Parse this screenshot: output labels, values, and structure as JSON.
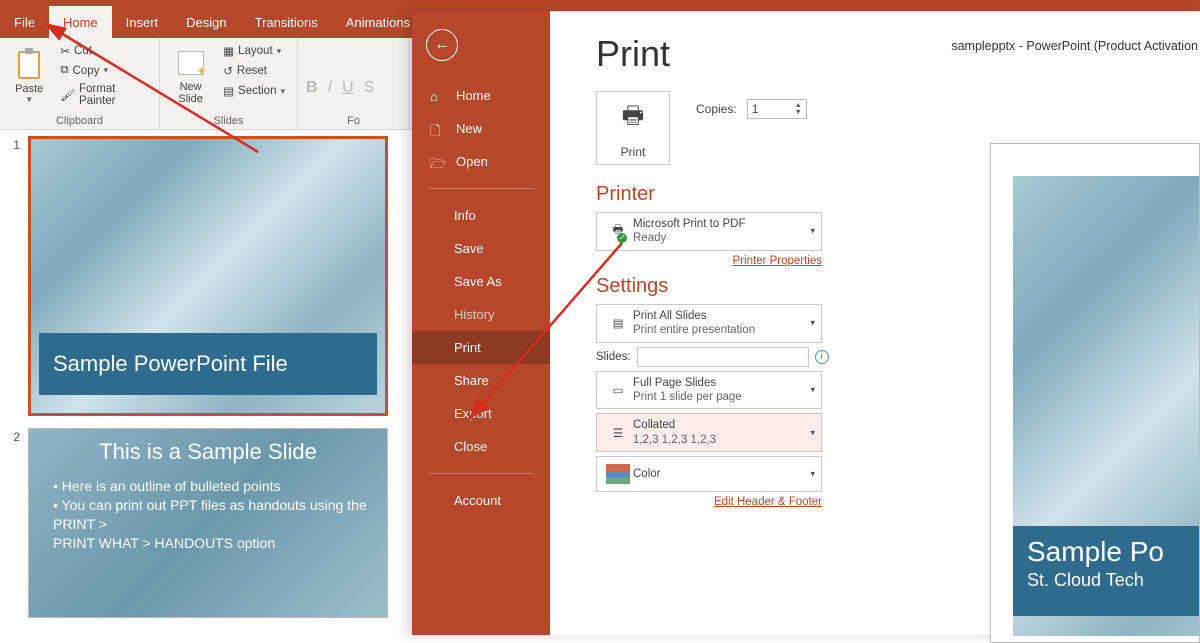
{
  "doc_title_line": "samplepptx  -  PowerPoint (Product Activation",
  "ribbon": {
    "tabs": [
      "File",
      "Home",
      "Insert",
      "Design",
      "Transitions",
      "Animations"
    ],
    "active_tab": "Home",
    "clipboard": {
      "paste": "Paste",
      "cut": "Cut",
      "copy": "Copy",
      "fp": "Format Painter",
      "group": "Clipboard"
    },
    "slides": {
      "new": "New\nSlide",
      "layout": "Layout",
      "reset": "Reset",
      "section": "Section",
      "group": "Slides"
    },
    "font_group_trunc": "Fo"
  },
  "thumbs": {
    "n1": "1",
    "t1_title": "Sample PowerPoint File",
    "n2": "2",
    "t2_title": "This is a Sample Slide",
    "t2_b1": "Here is an outline of bulleted points",
    "t2_b2": "You can print out PPT files as handouts using the",
    "t2_l3": "PRINT >",
    "t2_l4": " PRINT WHAT > HANDOUTS option"
  },
  "backstage": {
    "items": [
      "Home",
      "New",
      "Open",
      "Info",
      "Save",
      "Save As",
      "History",
      "Print",
      "Share",
      "Export",
      "Close",
      "Account"
    ],
    "active": "Print"
  },
  "print": {
    "title": "Print",
    "print_btn": "Print",
    "copies_label": "Copies:",
    "copies_value": "1",
    "printer_h": "Printer",
    "printer_name": "Microsoft Print to PDF",
    "printer_status": "Ready",
    "printer_props": "Printer Properties",
    "settings_h": "Settings",
    "s1a": "Print All Slides",
    "s1b": "Print entire presentation",
    "slides_label": "Slides:",
    "s2a": "Full Page Slides",
    "s2b": "Print 1 slide per page",
    "s3a": "Collated",
    "s3b": "1,2,3    1,2,3    1,2,3",
    "s4a": "Color",
    "edit_hf": "Edit Header & Footer"
  },
  "preview": {
    "t1": "Sample Po",
    "t2": "St. Cloud Tech"
  }
}
